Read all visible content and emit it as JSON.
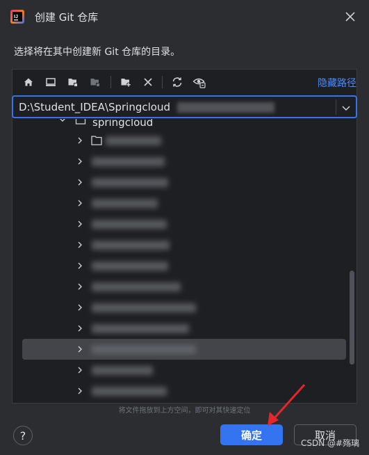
{
  "dialog": {
    "title": "创建 Git 仓库",
    "description": "选择将在其中创建新 Git 仓库的目录。"
  },
  "toolbar": {
    "hide_path_label": "隐藏路径",
    "icons": [
      "home-icon",
      "desktop-icon",
      "project-folder-icon",
      "module-folder-icon",
      "new-folder-icon",
      "delete-icon",
      "refresh-icon",
      "show-hidden-icon"
    ]
  },
  "path_input": {
    "value": "D:\\Student_IDEA\\Springcloud"
  },
  "tree": {
    "root_label": "springcloud",
    "rows": [
      {
        "kind": "folder"
      },
      {
        "kind": "module"
      },
      {
        "kind": "module"
      },
      {
        "kind": "module"
      },
      {
        "kind": "module"
      },
      {
        "kind": "module"
      },
      {
        "kind": "module"
      },
      {
        "kind": "module"
      },
      {
        "kind": "module"
      },
      {
        "kind": "module"
      },
      {
        "kind": "module",
        "selected": true
      },
      {
        "kind": "module"
      },
      {
        "kind": "module"
      }
    ]
  },
  "drop_hint": "将文件拖放到上方空间，即可对其快速定位",
  "buttons": {
    "ok_label": "确定",
    "cancel_label": "取消",
    "help_label": "?"
  },
  "watermark": "CSDN @#殇璃",
  "colors": {
    "accent": "#3574f0",
    "link": "#4c8cf7",
    "background": "#2b2d30",
    "panel": "#1e1f22",
    "selection": "#43454a",
    "annotation_arrow": "#e5272b"
  }
}
